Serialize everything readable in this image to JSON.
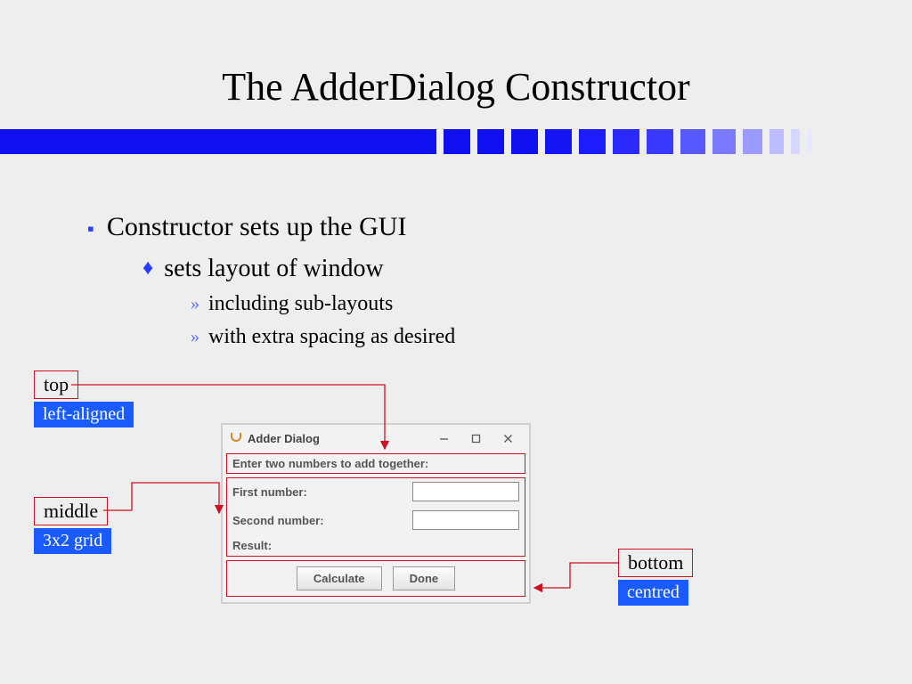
{
  "title": "The AdderDialog Constructor",
  "bullets": {
    "level1": "Constructor sets up the GUI",
    "level2": "sets layout of window",
    "level3a": "including sub-layouts",
    "level3b": "with extra spacing as desired"
  },
  "callouts": {
    "top": {
      "label": "top",
      "sub": "left-aligned"
    },
    "middle": {
      "label": "middle",
      "sub": "3x2 grid"
    },
    "bottom": {
      "label": "bottom",
      "sub": "centred"
    }
  },
  "dialog": {
    "title": "Adder Dialog",
    "instruction": "Enter two numbers to add together:",
    "first_label": "First number:",
    "second_label": "Second number:",
    "result_label": "Result:",
    "first_value": "",
    "second_value": "",
    "result_value": "",
    "calculate": "Calculate",
    "done": "Done"
  }
}
